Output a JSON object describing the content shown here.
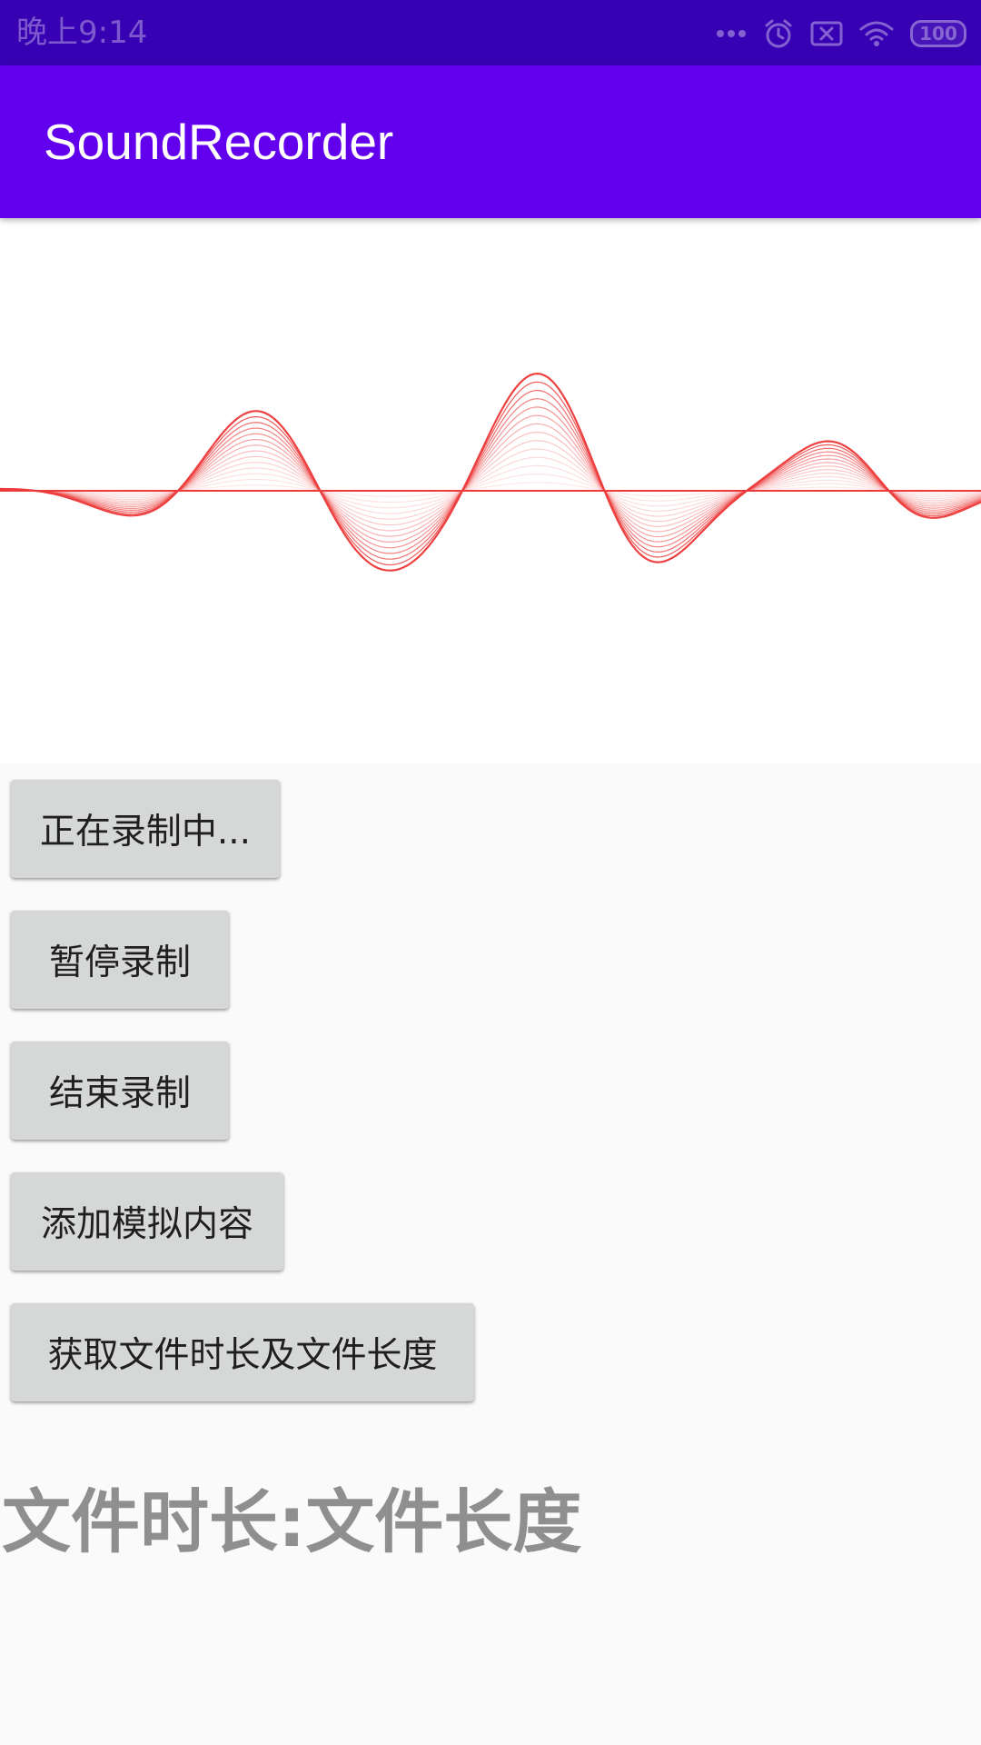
{
  "status_bar": {
    "time": "晚上9:14",
    "battery": "100",
    "icons": [
      "more-dots-icon",
      "alarm-icon",
      "sim-x-icon",
      "wifi-icon",
      "battery-icon"
    ]
  },
  "app_bar": {
    "title": "SoundRecorder",
    "color": "#6200ee",
    "status_color": "#3700b3"
  },
  "waveform": {
    "color": "#ec3b3b",
    "icon": "audio-waveform-icon"
  },
  "buttons": [
    {
      "label": "正在录制中..."
    },
    {
      "label": "暂停录制"
    },
    {
      "label": "结束录制"
    },
    {
      "label": "添加模拟内容"
    },
    {
      "label": "获取文件时长及文件长度"
    }
  ],
  "info": {
    "text": "文件时长:文件长度"
  }
}
